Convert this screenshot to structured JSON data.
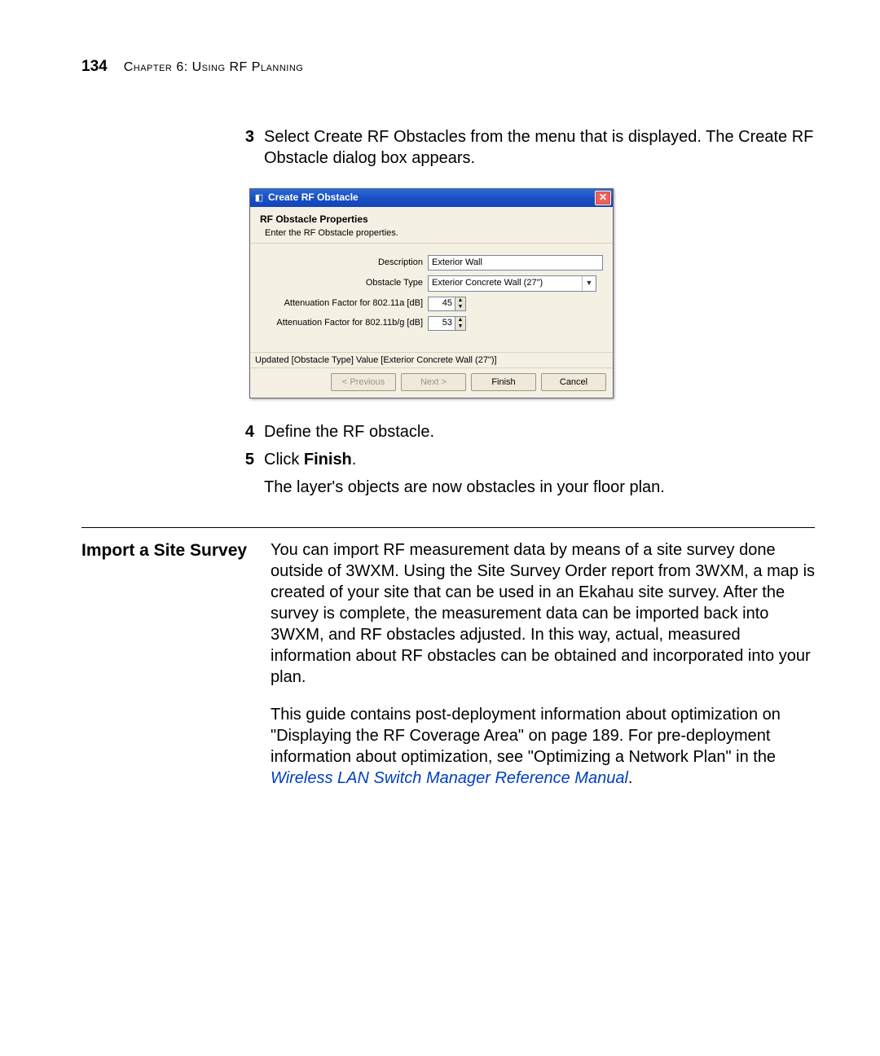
{
  "page": {
    "number": "134",
    "chapter": "Chapter 6: Using RF Planning"
  },
  "steps_a": {
    "s3": {
      "num": "3",
      "text": "Select Create RF Obstacles from the menu that is displayed. The Create RF Obstacle dialog box appears."
    },
    "s4": {
      "num": "4",
      "text": "Define the RF obstacle."
    },
    "s5": {
      "num": "5",
      "text_prefix": "Click ",
      "bold": "Finish",
      "suffix": "."
    },
    "after": "The layer's objects are now obstacles in your floor plan."
  },
  "dialog": {
    "title": "Create RF Obstacle",
    "section_title": "RF Obstacle Properties",
    "section_sub": "Enter the RF Obstacle properties.",
    "labels": {
      "description": "Description",
      "obstacle_type": "Obstacle Type",
      "att_a": "Attenuation Factor for 802.11a [dB]",
      "att_bg": "Attenuation Factor for 802.11b/g [dB]"
    },
    "values": {
      "description": "Exterior Wall",
      "obstacle_type": "Exterior Concrete Wall (27\")",
      "att_a": "45",
      "att_bg": "53"
    },
    "status": "Updated [Obstacle Type] Value [Exterior Concrete Wall (27\")]",
    "buttons": {
      "previous": "< Previous",
      "next": "Next >",
      "finish": "Finish",
      "cancel": "Cancel"
    }
  },
  "section": {
    "heading": "Import a Site Survey",
    "p1": "You can import RF measurement data by means of a site survey done outside of 3WXM. Using the Site Survey Order report from 3WXM, a map is created of your site that can be used in an Ekahau site survey. After the survey is complete, the measurement data can be imported back into 3WXM, and RF obstacles adjusted. In this way, actual, measured information about RF obstacles can be obtained and incorporated into your plan.",
    "p2_a": "This guide contains post-deployment information about optimization on \"Displaying the RF Coverage Area\" on page 189. For pre-deployment information about optimization, see \"Optimizing a Network Plan\" in the ",
    "p2_link": "Wireless LAN Switch Manager Reference Manual",
    "p2_b": "."
  }
}
